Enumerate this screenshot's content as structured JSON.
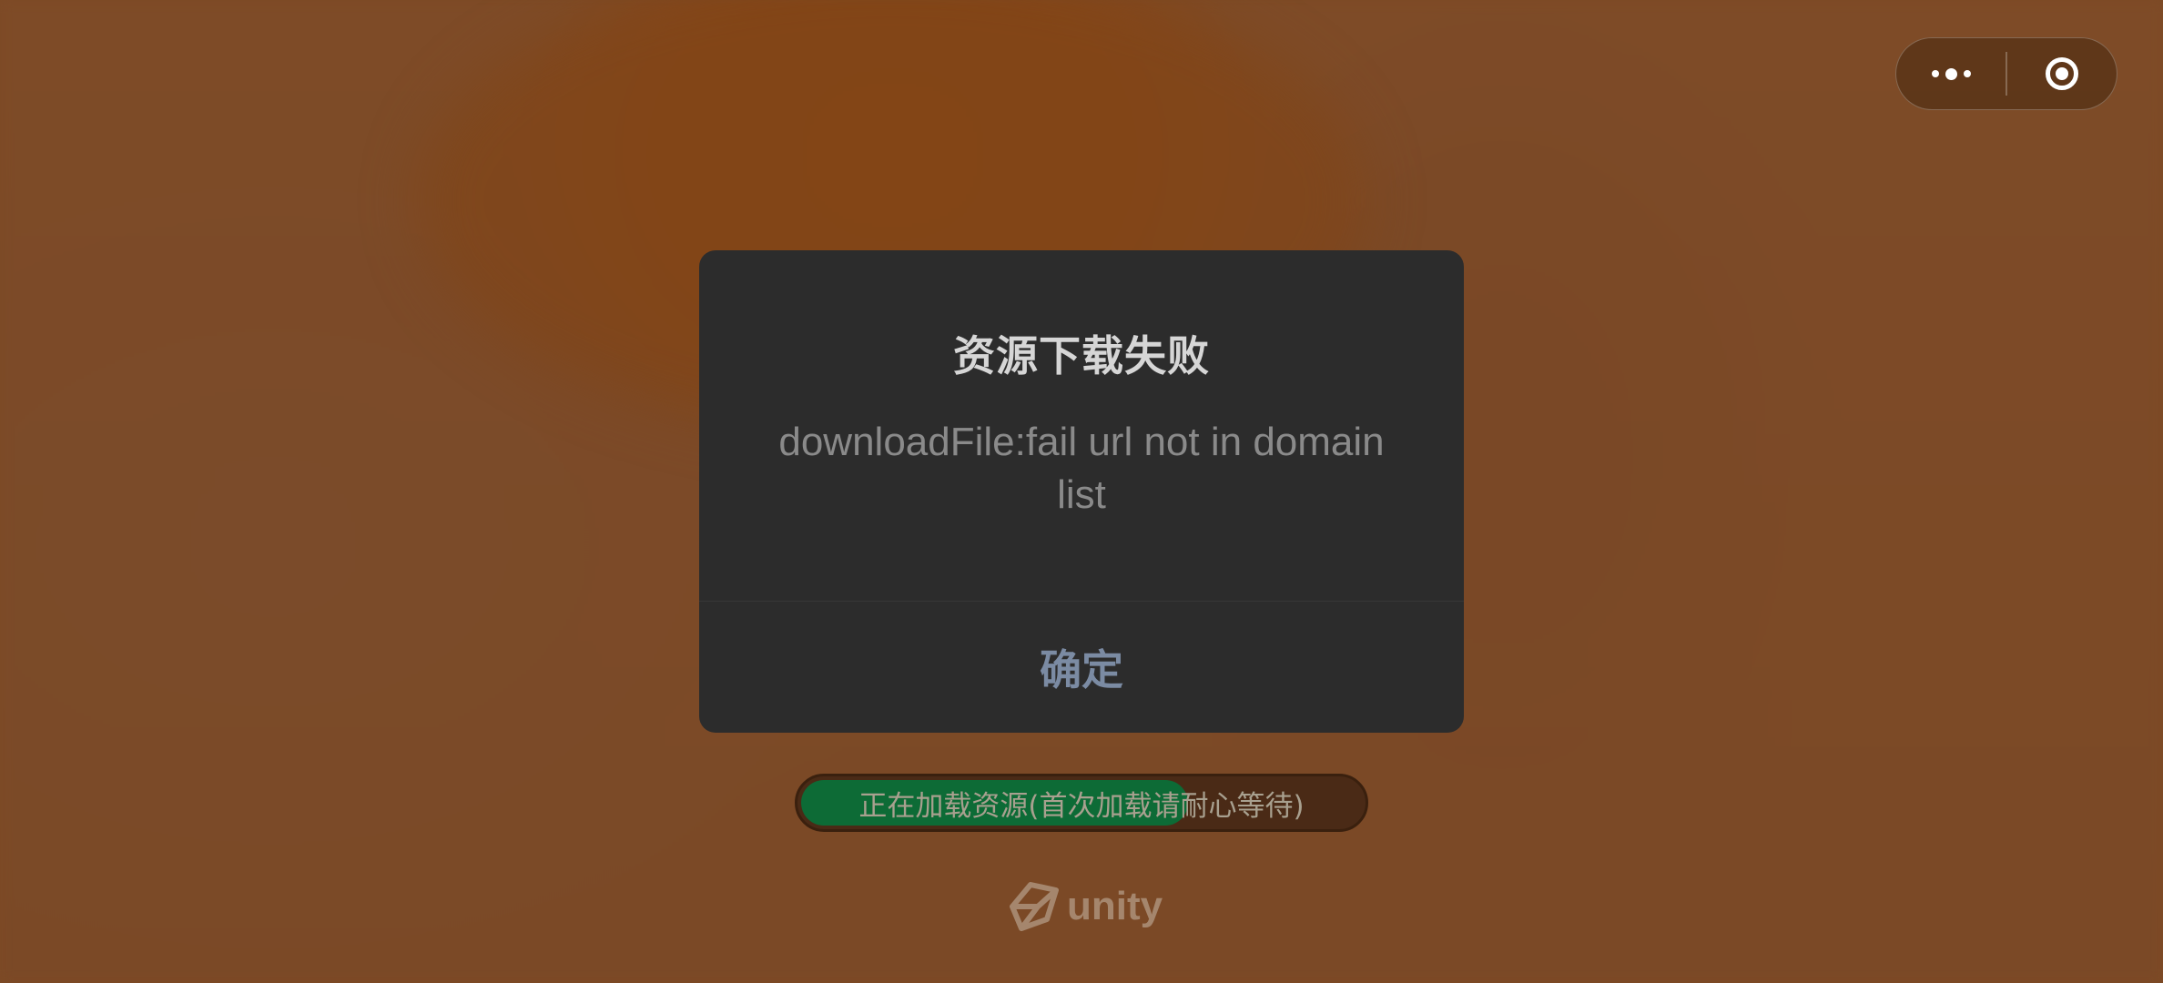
{
  "dialog": {
    "title": "资源下载失败",
    "message": "downloadFile:fail url not in domain list",
    "confirm_label": "确定"
  },
  "loading": {
    "text": "正在加载资源(首次加载请耐心等待)",
    "progress": 0.69
  },
  "logo": {
    "text": "unity"
  },
  "capsule": {
    "menu_icon": "more-dots-icon",
    "close_icon": "target-circle-icon"
  },
  "colors": {
    "background": "#7d4a25",
    "dialog": "#2c2c2c",
    "progress_fill": "#0d6b36",
    "confirm_text": "#7b8ba3"
  }
}
